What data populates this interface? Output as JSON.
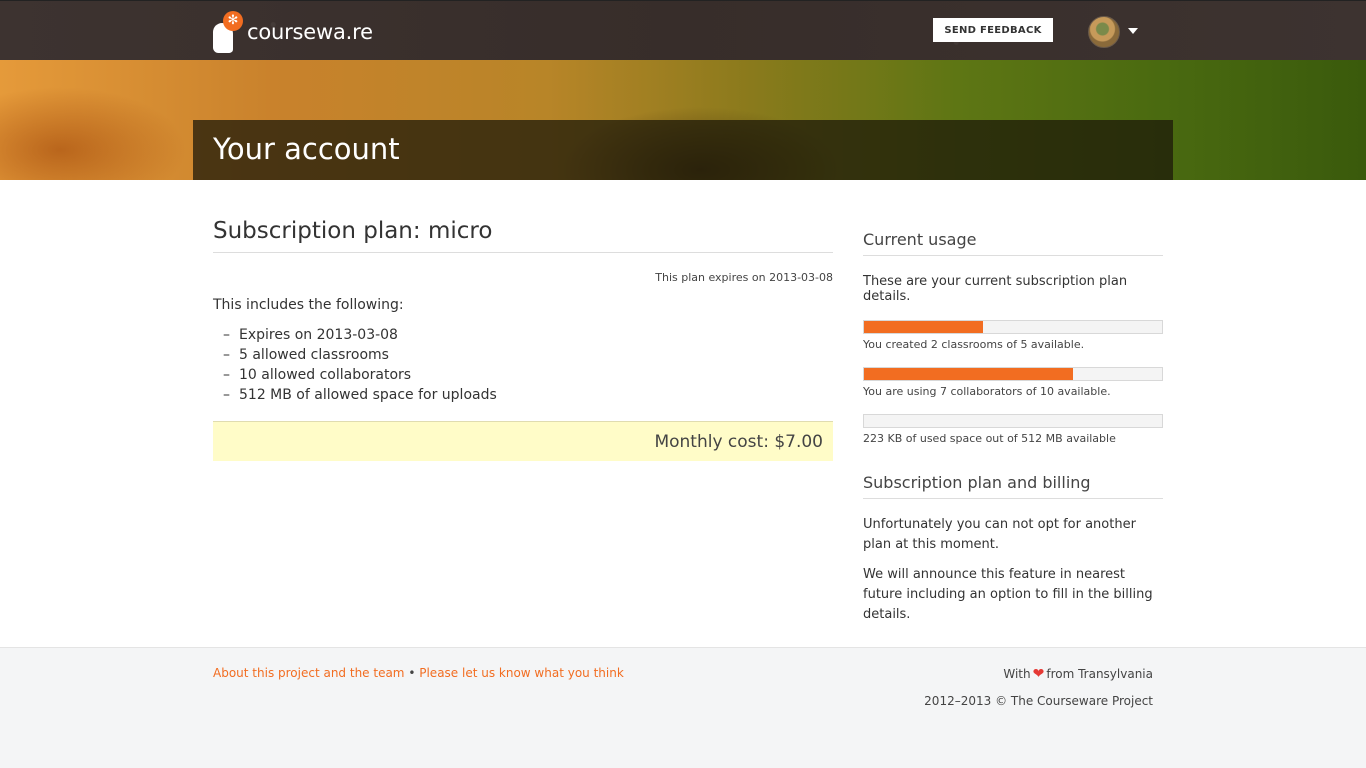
{
  "header": {
    "logo_text": "coursewa.re",
    "feedback_label": "SEND FEEDBACK"
  },
  "hero": {
    "title": "Your account"
  },
  "plan": {
    "title": "Subscription plan: micro",
    "expires_note": "This plan expires on 2013-03-08",
    "includes_label": "This includes the following:",
    "items": [
      "Expires on 2013-03-08",
      "5 allowed classrooms",
      "10 allowed collaborators",
      "512 MB of allowed space for uploads"
    ],
    "monthly_cost": "Monthly cost: $7.00"
  },
  "usage": {
    "heading": "Current usage",
    "intro": "These are your current subscription plan details.",
    "meters": [
      {
        "fraction": 0.4,
        "text": "You created 2 classrooms of 5 available."
      },
      {
        "fraction": 0.7,
        "text": "You are using 7 collaborators of 10 available."
      },
      {
        "fraction": 0.0,
        "text": "223 KB of used space out of 512 MB available"
      }
    ]
  },
  "billing": {
    "heading": "Subscription plan and billing",
    "paragraph1": "Unfortunately you can not opt for another plan at this moment.",
    "paragraph2": "We will announce this feature in nearest future including an option to fill in the billing details."
  },
  "footer": {
    "link_about": "About this project and the team",
    "separator": "•",
    "link_feedback": "Please let us know what you think",
    "love_prefix": "With",
    "love_suffix": "from Transylvania",
    "copyright": "2012–2013 © The Courseware Project"
  },
  "colors": {
    "accent": "#f26d21",
    "topbar": "#3a302c",
    "cost_box": "#fffcc8",
    "heart": "#e53935"
  }
}
